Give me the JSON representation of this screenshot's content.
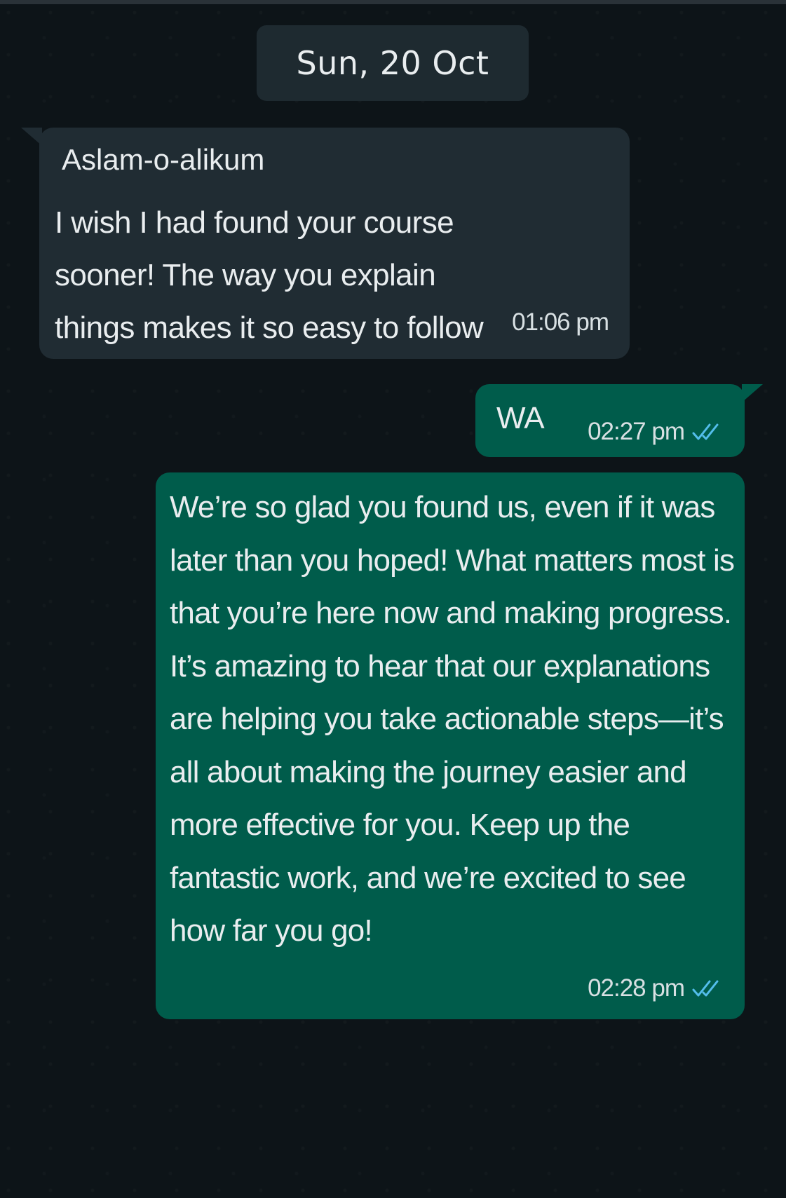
{
  "chat": {
    "date_separator": "Sun, 20 Oct",
    "messages": [
      {
        "direction": "incoming",
        "first_line": "Aslam-o-alikum",
        "text": "I wish I had found your course sooner! The way you explain things makes it so easy to follow",
        "time": "01:06 pm"
      },
      {
        "direction": "outgoing",
        "text": "WA",
        "time": "02:27 pm",
        "status_icon": "double-check-icon"
      },
      {
        "direction": "outgoing",
        "text": "We’re so glad you found us, even if it was later than you hoped! What matters most is that you’re here now and making progress. It’s amazing to hear that our explanations are helping you take actionable steps—it’s all about making the journey easier and more effective for you. Keep up the fantastic work, and we’re excited to see how far you go!",
        "time": "02:28 pm",
        "status_icon": "double-check-icon"
      }
    ]
  },
  "colors": {
    "background": "#0d1418",
    "incoming_bubble": "#202c33",
    "outgoing_bubble": "#005c4b",
    "read_tick": "#53bdeb"
  }
}
